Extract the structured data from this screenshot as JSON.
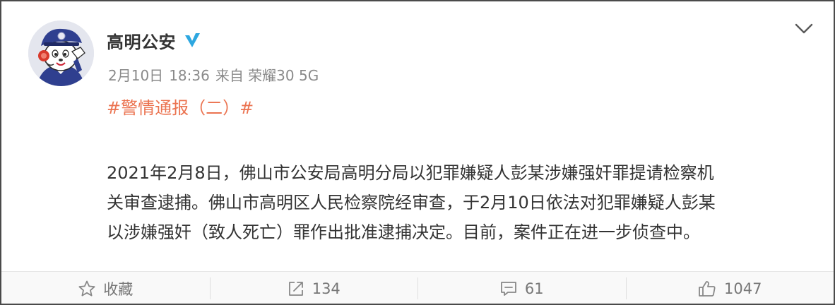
{
  "post": {
    "author": "高明公安",
    "date": "2月10日",
    "time": "18:36",
    "source": "来自 荣耀30 5G",
    "topic": "#警情通报（二）#",
    "body_lines": [
      "2021年2月8日，佛山市公安局高明分局以犯罪嫌疑人彭某涉嫌强奸罪提请检察机",
      "关审查逮捕。佛山市高明区人民检察院经审查，于2月10日依法对犯罪嫌疑人彭某",
      "以涉嫌强奸（致人死亡）罪作出批准逮捕决定。目前，案件正在进一步侦查中。"
    ]
  },
  "actions": {
    "favorite_label": "收藏",
    "repost_count": "134",
    "comment_count": "61",
    "like_count": "1047"
  },
  "icons": {
    "verified": "verified-v-icon",
    "menu": "chevron-down-icon",
    "favorite": "star-icon",
    "repost": "share-arrow-icon",
    "comment": "comment-bubble-icon",
    "like": "thumbs-up-icon"
  },
  "colors": {
    "topic": "#eb7350",
    "verified": "#2da7e0",
    "meta": "#8a8a8a",
    "avatar_bg": "#e4e6ee"
  }
}
